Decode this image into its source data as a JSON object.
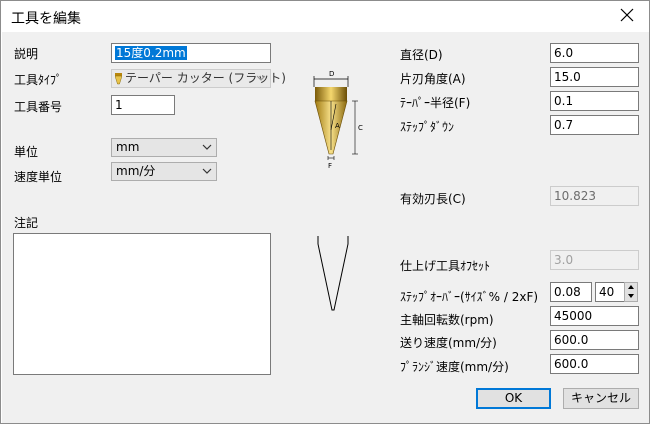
{
  "window": {
    "title": "工具を編集"
  },
  "left": {
    "description_label": "説明",
    "description_value": "15度0.2mm",
    "tool_type_label": "工具ﾀｲﾌﾟ",
    "tool_type_value": "テーパー カッター (フラット)",
    "tool_number_label": "工具番号",
    "tool_number_value": "1",
    "unit_label": "単位",
    "unit_value": "mm",
    "speed_unit_label": "速度単位",
    "speed_unit_value": "mm/分",
    "notes_label": "注記"
  },
  "diagram": {
    "label_d": "D",
    "label_a": "A",
    "label_c": "C",
    "label_f": "F"
  },
  "right": {
    "diameter_label": "直径(D)",
    "diameter_value": "6.0",
    "half_angle_label": "片刃角度(A)",
    "half_angle_value": "15.0",
    "taper_radius_label": "ﾃｰﾊﾟｰ半径(F)",
    "taper_radius_value": "0.1",
    "stepdown_label": "ｽﾃｯﾌﾟﾀﾞｳﾝ",
    "stepdown_value": "0.7",
    "flute_length_label": "有効刃長(C)",
    "flute_length_value": "10.823",
    "finish_offset_label": "仕上げ工具ｵﾌｾｯﾄ",
    "finish_offset_value": "3.0",
    "stepover_label": "ｽﾃｯﾌﾟｵｰﾊﾞｰ(ｻｲｽﾞ% / 2xF)",
    "stepover_value": "0.08",
    "stepover_percent": "40",
    "spindle_label": "主軸回転数(rpm)",
    "spindle_value": "45000",
    "feed_label": "送り速度(mm/分)",
    "feed_value": "600.0",
    "plunge_label": "ﾌﾟﾗﾝｼﾞ速度(mm/分)",
    "plunge_value": "600.0"
  },
  "buttons": {
    "ok": "OK",
    "cancel": "キャンセル"
  }
}
